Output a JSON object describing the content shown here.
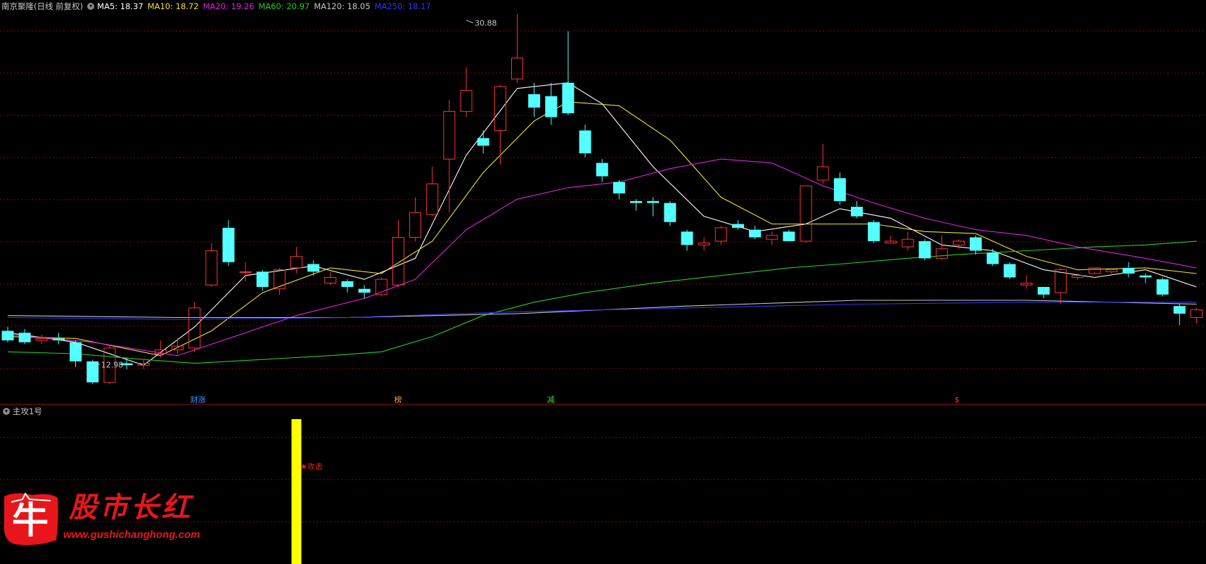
{
  "header": {
    "stock": "南京聚隆(日线 前复权)",
    "ma": [
      {
        "label": "MA5: 18.37",
        "color": "#ffffff"
      },
      {
        "label": "MA10: 18.72",
        "color": "#f0e030"
      },
      {
        "label": "MA20: 19.26",
        "color": "#e020e0"
      },
      {
        "label": "MA60: 20.97",
        "color": "#20d020"
      },
      {
        "label": "MA120: 18.05",
        "color": "#c8c8c8"
      },
      {
        "label": "MA250: 18.17",
        "color": "#3333ee"
      }
    ]
  },
  "sub_panel": {
    "title": "主攻1号",
    "signal": "★攻击"
  },
  "logo": {
    "glyph": "牛",
    "title": "股市长红",
    "url": "www.gushichanghong.com"
  },
  "colors": {
    "up": "#ff3333",
    "down": "#54ffff",
    "grid": "#7a1010",
    "separator": "#a01010"
  },
  "chart_data": {
    "type": "candlestick",
    "y_range": [
      11.3,
      31.2
    ],
    "annotations": [
      {
        "text": "30.88",
        "index": 27,
        "price": 30.88
      },
      {
        "text": "12.98",
        "index": 5,
        "price": 12.98
      }
    ],
    "markers": [
      {
        "text": "财涨",
        "index": 11,
        "color": "#3399ff"
      },
      {
        "text": "榜",
        "index": 23,
        "color": "#ff9933"
      },
      {
        "text": "减",
        "index": 32,
        "color": "#33dd33"
      },
      {
        "text": "$",
        "index": 56,
        "color": "#ff3333"
      }
    ],
    "candles": [
      [
        14.6,
        14.1,
        14.8,
        14.0
      ],
      [
        14.5,
        14.0,
        14.7,
        13.9
      ],
      [
        14.1,
        14.2,
        14.4,
        13.9
      ],
      [
        14.2,
        14.1,
        14.5,
        13.9
      ],
      [
        14.0,
        13.0,
        14.1,
        12.7
      ],
      [
        13.0,
        11.9,
        13.1,
        11.8
      ],
      [
        11.9,
        13.7,
        13.8,
        11.8
      ],
      [
        12.9,
        12.8,
        13.2,
        12.6
      ],
      [
        12.8,
        12.9,
        13.1,
        12.6
      ],
      [
        13.4,
        13.6,
        14.1,
        13.2
      ],
      [
        13.6,
        13.8,
        14.2,
        13.4
      ],
      [
        13.7,
        15.8,
        16.1,
        13.5
      ],
      [
        17.0,
        18.8,
        19.2,
        16.9
      ],
      [
        20.0,
        18.2,
        20.4,
        18.0
      ],
      [
        17.7,
        17.7,
        18.2,
        17.2
      ],
      [
        17.7,
        16.9,
        17.8,
        16.7
      ],
      [
        16.8,
        17.8,
        17.9,
        16.5
      ],
      [
        17.9,
        18.5,
        19.0,
        17.6
      ],
      [
        18.1,
        17.7,
        18.3,
        17.5
      ],
      [
        17.1,
        17.4,
        17.7,
        17.0
      ],
      [
        17.2,
        16.9,
        17.3,
        16.6
      ],
      [
        16.8,
        16.6,
        17.0,
        16.3
      ],
      [
        16.5,
        17.3,
        17.4,
        16.4
      ],
      [
        17.0,
        19.5,
        20.4,
        16.9
      ],
      [
        19.5,
        20.8,
        21.6,
        19.3
      ],
      [
        20.7,
        22.3,
        23.2,
        20.6
      ],
      [
        23.6,
        26.1,
        26.7,
        20.8
      ],
      [
        26.1,
        27.2,
        28.4,
        25.8
      ],
      [
        24.7,
        24.3,
        25.1,
        23.9
      ],
      [
        25.1,
        27.4,
        27.5,
        23.3
      ],
      [
        27.8,
        28.9,
        31.2,
        27.6
      ],
      [
        27.0,
        26.3,
        27.6,
        25.8
      ],
      [
        26.9,
        25.8,
        27.6,
        25.4
      ],
      [
        27.6,
        26.0,
        30.3,
        25.9
      ],
      [
        25.1,
        23.9,
        25.4,
        23.7
      ],
      [
        23.4,
        22.7,
        23.6,
        22.4
      ],
      [
        22.4,
        21.8,
        22.5,
        21.5
      ],
      [
        21.4,
        21.3,
        21.5,
        20.9
      ],
      [
        21.4,
        21.3,
        21.6,
        20.6
      ],
      [
        21.3,
        20.3,
        21.4,
        20.1
      ],
      [
        19.8,
        19.1,
        19.9,
        18.8
      ],
      [
        19.1,
        19.2,
        19.5,
        18.8
      ],
      [
        19.3,
        20.0,
        20.1,
        19.1
      ],
      [
        20.2,
        20.0,
        20.4,
        19.9
      ],
      [
        19.9,
        19.5,
        20.1,
        19.4
      ],
      [
        19.4,
        19.6,
        19.8,
        19.1
      ],
      [
        19.8,
        19.3,
        19.9,
        19.3
      ],
      [
        19.3,
        22.2,
        22.2,
        19.2
      ],
      [
        22.5,
        23.2,
        24.4,
        22.3
      ],
      [
        22.6,
        21.4,
        22.9,
        21.2
      ],
      [
        21.1,
        20.6,
        21.4,
        20.5
      ],
      [
        20.3,
        19.3,
        20.4,
        19.2
      ],
      [
        19.2,
        19.3,
        19.6,
        19.2
      ],
      [
        19.0,
        19.4,
        19.8,
        18.8
      ],
      [
        19.3,
        18.4,
        19.4,
        18.3
      ],
      [
        18.4,
        18.9,
        19.6,
        18.3
      ],
      [
        19.1,
        19.3,
        19.4,
        18.9
      ],
      [
        19.5,
        18.8,
        19.6,
        18.6
      ],
      [
        18.7,
        18.1,
        18.9,
        18.0
      ],
      [
        18.1,
        17.4,
        18.2,
        17.3
      ],
      [
        17.0,
        17.1,
        17.5,
        16.8
      ],
      [
        16.9,
        16.5,
        16.9,
        16.3
      ],
      [
        16.6,
        17.8,
        17.9,
        16.0
      ],
      [
        17.4,
        17.5,
        17.6,
        17.3
      ],
      [
        17.6,
        17.9,
        17.9,
        17.7
      ],
      [
        17.7,
        17.8,
        17.9,
        17.6
      ],
      [
        17.9,
        17.6,
        18.2,
        17.4
      ],
      [
        17.5,
        17.4,
        17.6,
        17.1
      ],
      [
        17.3,
        16.5,
        17.4,
        16.4
      ],
      [
        15.9,
        15.5,
        16.0,
        14.9
      ],
      [
        15.3,
        15.7,
        15.8,
        15.0
      ]
    ],
    "ma_lines": {
      "ma5": [
        [
          0,
          14.5
        ],
        [
          4,
          14.0
        ],
        [
          8,
          12.8
        ],
        [
          11,
          14.8
        ],
        [
          14,
          17.5
        ],
        [
          18,
          18.0
        ],
        [
          21,
          17.3
        ],
        [
          24,
          18.4
        ],
        [
          27,
          23.8
        ],
        [
          30,
          27.3
        ],
        [
          33,
          27.6
        ],
        [
          35,
          26.5
        ],
        [
          38,
          23.2
        ],
        [
          41,
          20.6
        ],
        [
          44,
          19.8
        ],
        [
          47,
          20.2
        ],
        [
          49,
          21.0
        ],
        [
          52,
          20.5
        ],
        [
          55,
          19.1
        ],
        [
          58,
          18.8
        ],
        [
          61,
          17.8
        ],
        [
          64,
          17.4
        ],
        [
          67,
          17.8
        ],
        [
          70,
          16.9
        ]
      ],
      "ma10": [
        [
          0,
          14.3
        ],
        [
          4,
          14.2
        ],
        [
          9,
          13.3
        ],
        [
          12,
          14.6
        ],
        [
          15,
          16.6
        ],
        [
          19,
          17.9
        ],
        [
          22,
          17.6
        ],
        [
          25,
          19.3
        ],
        [
          28,
          22.9
        ],
        [
          31,
          25.6
        ],
        [
          33,
          26.6
        ],
        [
          36,
          26.4
        ],
        [
          39,
          24.6
        ],
        [
          42,
          21.6
        ],
        [
          45,
          20.2
        ],
        [
          48,
          20.2
        ],
        [
          51,
          20.2
        ],
        [
          54,
          19.8
        ],
        [
          57,
          19.7
        ],
        [
          60,
          18.5
        ],
        [
          63,
          17.8
        ],
        [
          67,
          17.9
        ],
        [
          70,
          17.6
        ]
      ],
      "ma20": [
        [
          0,
          14.4
        ],
        [
          5,
          14.0
        ],
        [
          10,
          13.3
        ],
        [
          14,
          14.5
        ],
        [
          17,
          15.4
        ],
        [
          21,
          16.3
        ],
        [
          24,
          17.3
        ],
        [
          27,
          19.9
        ],
        [
          30,
          21.5
        ],
        [
          33,
          22.1
        ],
        [
          36,
          22.4
        ],
        [
          39,
          23.1
        ],
        [
          42,
          23.6
        ],
        [
          45,
          23.4
        ],
        [
          48,
          22.2
        ],
        [
          51,
          21.3
        ],
        [
          54,
          20.5
        ],
        [
          57,
          19.9
        ],
        [
          60,
          19.6
        ],
        [
          63,
          19.0
        ],
        [
          67,
          18.4
        ],
        [
          70,
          17.9
        ]
      ],
      "ma60": [
        [
          0,
          13.5
        ],
        [
          4,
          13.4
        ],
        [
          8,
          13.1
        ],
        [
          11,
          12.9
        ],
        [
          15,
          13.1
        ],
        [
          19,
          13.3
        ],
        [
          22,
          13.5
        ],
        [
          25,
          14.3
        ],
        [
          28,
          15.4
        ],
        [
          31,
          16.1
        ],
        [
          34,
          16.6
        ],
        [
          38,
          17.1
        ],
        [
          42,
          17.5
        ],
        [
          46,
          17.9
        ],
        [
          49,
          18.1
        ],
        [
          53,
          18.4
        ],
        [
          56,
          18.6
        ],
        [
          60,
          18.8
        ],
        [
          64,
          19.0
        ],
        [
          67,
          19.1
        ],
        [
          70,
          19.3
        ]
      ],
      "ma120": [
        [
          0,
          15.4
        ],
        [
          10,
          15.3
        ],
        [
          20,
          15.3
        ],
        [
          30,
          15.5
        ],
        [
          40,
          15.9
        ],
        [
          50,
          16.2
        ],
        [
          60,
          16.2
        ],
        [
          70,
          16.0
        ]
      ],
      "ma250": [
        [
          0,
          15.3
        ],
        [
          10,
          15.2
        ],
        [
          20,
          15.3
        ],
        [
          30,
          15.6
        ],
        [
          40,
          15.8
        ],
        [
          50,
          16.0
        ],
        [
          60,
          16.1
        ],
        [
          70,
          16.1
        ]
      ]
    },
    "sub_bars": [
      {
        "index": 17,
        "height_fraction": 1.0
      }
    ]
  }
}
